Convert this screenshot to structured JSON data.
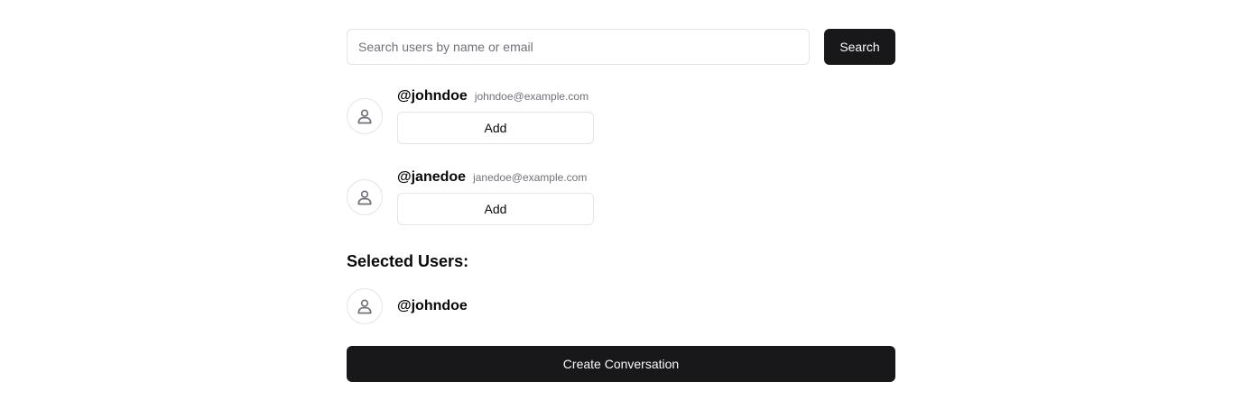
{
  "search": {
    "placeholder": "Search users by name or email",
    "value": "",
    "button_label": "Search"
  },
  "results": [
    {
      "username": "@johndoe",
      "email": "johndoe@example.com",
      "action_label": "Add",
      "icon": "user-icon"
    },
    {
      "username": "@janedoe",
      "email": "janedoe@example.com",
      "action_label": "Add",
      "icon": "user-icon"
    }
  ],
  "selected": {
    "title": "Selected Users:",
    "users": [
      {
        "username": "@johndoe",
        "icon": "user-icon"
      }
    ]
  },
  "create_button_label": "Create Conversation",
  "colors": {
    "primary": "#18181b",
    "border": "#e4e4e7",
    "muted_text": "#71717a",
    "avatar_icon": "#71717a"
  }
}
